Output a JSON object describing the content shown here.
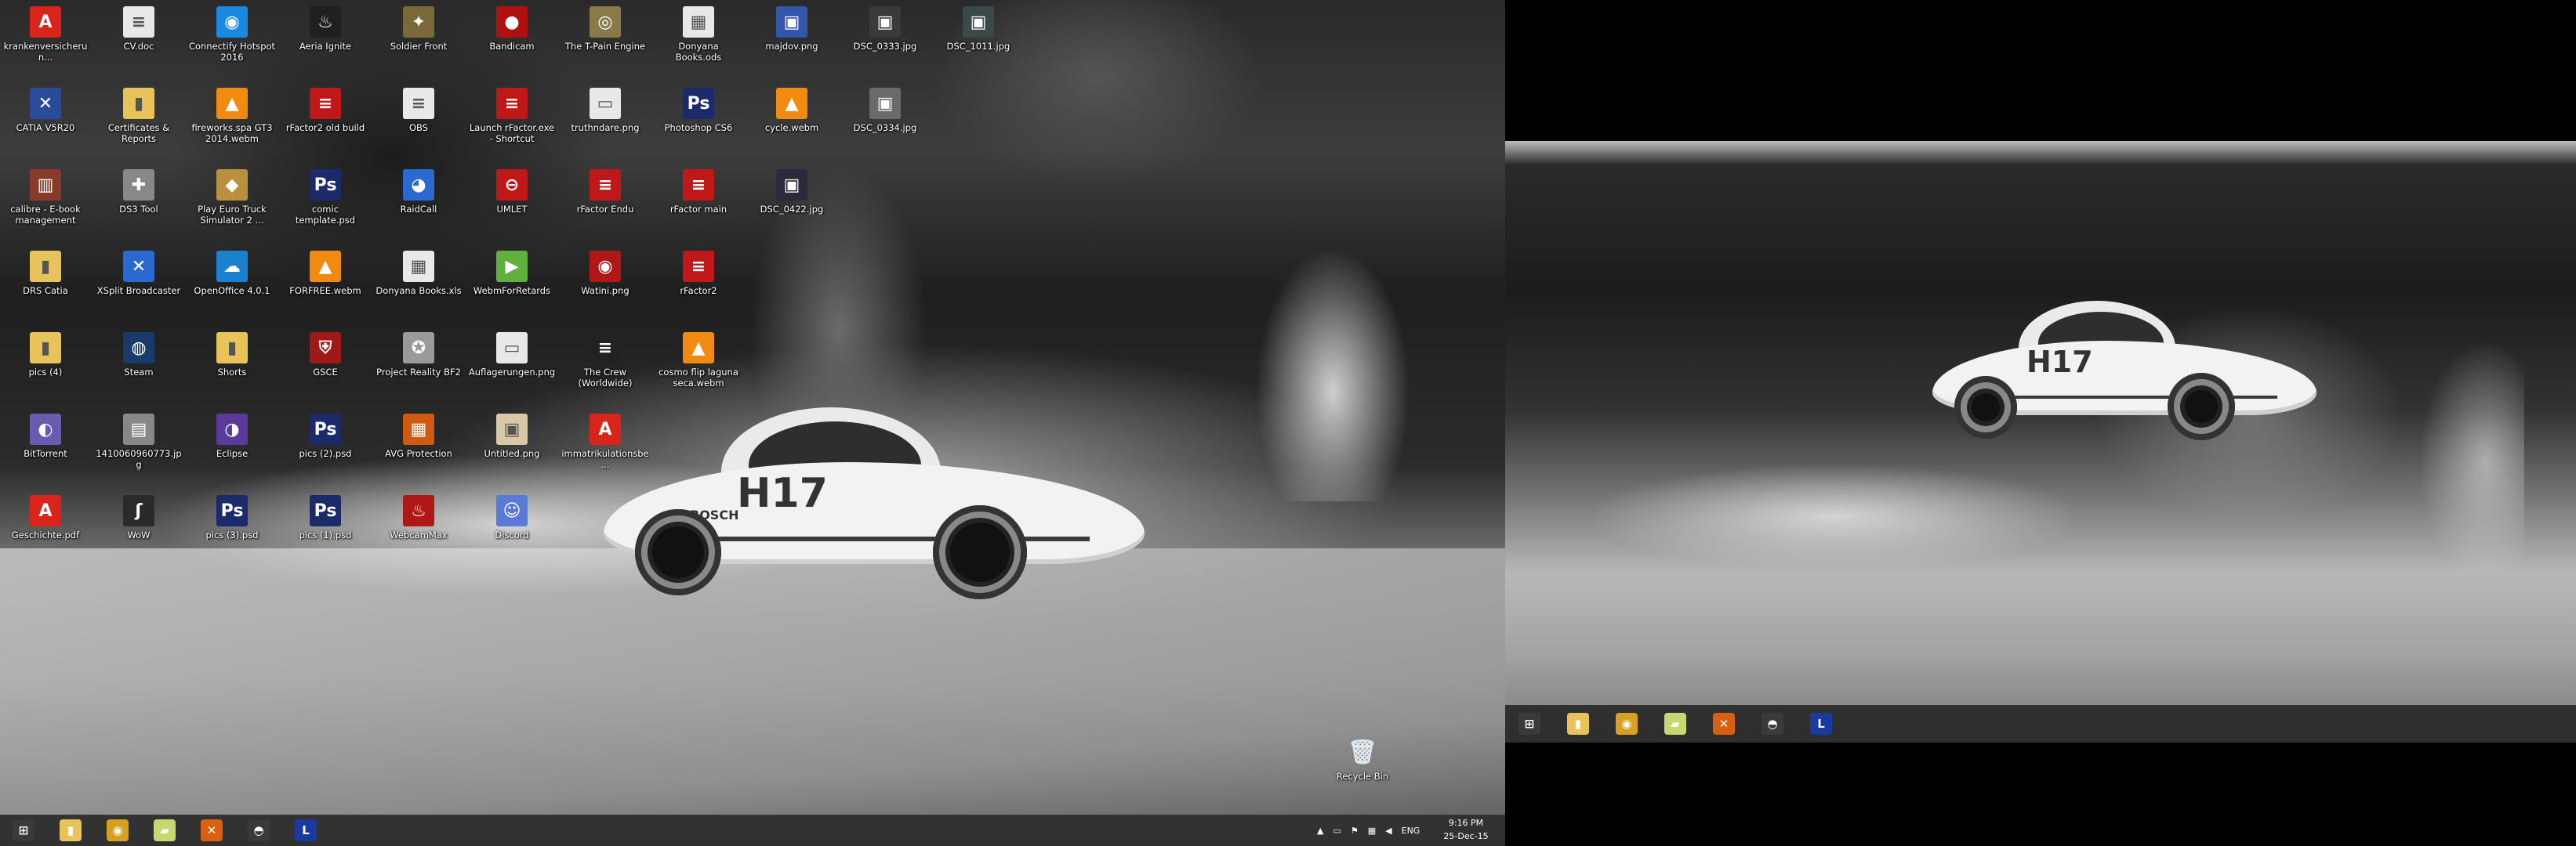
{
  "desktop_left": {
    "icons": [
      {
        "label": "krankenversicherun...",
        "kind": "pdf-icon",
        "color": "#d9241c",
        "glyph": "A"
      },
      {
        "label": "CV.doc",
        "kind": "document-icon",
        "color": "#e8e8e8",
        "glyph": "≡"
      },
      {
        "label": "Connectify Hotspot 2016",
        "kind": "wifi-app-icon",
        "color": "#1a8ae0",
        "glyph": "◉"
      },
      {
        "label": "Aeria Ignite",
        "kind": "flame-app-icon",
        "color": "#202020",
        "glyph": "♨"
      },
      {
        "label": "Soldier Front",
        "kind": "game-emblem-icon",
        "color": "#7a6a3a",
        "glyph": "✦"
      },
      {
        "label": "Bandicam",
        "kind": "record-app-icon",
        "color": "#b01010",
        "glyph": "●"
      },
      {
        "label": "The T-Pain Engine",
        "kind": "medallion-icon",
        "color": "#8a7a4a",
        "glyph": "◎"
      },
      {
        "label": "Donyana Books.ods",
        "kind": "spreadsheet-icon",
        "color": "#e8e8e8",
        "glyph": "▦"
      },
      {
        "label": "majdov.png",
        "kind": "image-file-icon",
        "color": "#3355aa",
        "glyph": "▣"
      },
      {
        "label": "DSC_0333.jpg",
        "kind": "photo-icon",
        "color": "#3a3a3a",
        "glyph": "▣"
      },
      {
        "label": "DSC_1011.jpg",
        "kind": "photo-icon",
        "color": "#3a4a48",
        "glyph": "▣"
      },
      {
        "label": "CATIA V5R20",
        "kind": "catia-icon",
        "color": "#2a4a9a",
        "glyph": "✕"
      },
      {
        "label": "Certificates & Reports",
        "kind": "folder-icon",
        "color": "#e8c35a",
        "glyph": "▮"
      },
      {
        "label": "fireworks.spa GT3 2014.webm",
        "kind": "vlc-cone-icon",
        "color": "#f08a10",
        "glyph": "▲"
      },
      {
        "label": "rFactor2 old build",
        "kind": "rfactor-icon",
        "color": "#c01818",
        "glyph": "≡"
      },
      {
        "label": "OBS",
        "kind": "document-icon",
        "color": "#e8e8e8",
        "glyph": "≡"
      },
      {
        "label": "Launch rFactor.exe - Shortcut",
        "kind": "rfactor-icon",
        "color": "#c01818",
        "glyph": "≡"
      },
      {
        "label": "truthndare.png",
        "kind": "image-file-icon",
        "color": "#e8e8e8",
        "glyph": "▭"
      },
      {
        "label": "Photoshop CS6",
        "kind": "photoshop-icon",
        "color": "#1a2a6a",
        "glyph": "Ps"
      },
      {
        "label": "cycle.webm",
        "kind": "vlc-cone-icon",
        "color": "#f08a10",
        "glyph": "▲"
      },
      {
        "label": "DSC_0334.jpg",
        "kind": "photo-icon",
        "color": "#6a6a6a",
        "glyph": "▣"
      },
      {
        "label": "calibre - E-book management",
        "kind": "books-icon",
        "color": "#8a3a2a",
        "glyph": "▥"
      },
      {
        "label": "DS3 Tool",
        "kind": "gamepad-icon",
        "color": "#888888",
        "glyph": "✚"
      },
      {
        "label": "Play Euro Truck Simulator 2 ...",
        "kind": "truck-game-icon",
        "color": "#b89040",
        "glyph": "◆"
      },
      {
        "label": "comic template.psd",
        "kind": "photoshop-icon",
        "color": "#1a2a6a",
        "glyph": "Ps"
      },
      {
        "label": "RaidCall",
        "kind": "chat-app-icon",
        "color": "#2a6ad0",
        "glyph": "◕"
      },
      {
        "label": "UMLET",
        "kind": "london-roundel-icon",
        "color": "#c01818",
        "glyph": "⊖"
      },
      {
        "label": "rFactor Endu",
        "kind": "rfactor-icon",
        "color": "#c01818",
        "glyph": "≡"
      },
      {
        "label": "rFactor main",
        "kind": "rfactor-icon",
        "color": "#c01818",
        "glyph": "≡"
      },
      {
        "label": "DSC_0422.jpg",
        "kind": "photo-icon",
        "color": "#2a2a3a",
        "glyph": "▣"
      },
      {
        "label": "DRS Catia",
        "kind": "folder-icon",
        "color": "#e8c35a",
        "glyph": "▮"
      },
      {
        "label": "XSplit Broadcaster",
        "kind": "broadcast-app-icon",
        "color": "#2a6ad0",
        "glyph": "✕"
      },
      {
        "label": "OpenOffice 4.0.1",
        "kind": "openoffice-icon",
        "color": "#1a80d0",
        "glyph": "☁"
      },
      {
        "label": "FORFREE.webm",
        "kind": "vlc-cone-icon",
        "color": "#f08a10",
        "glyph": "▲"
      },
      {
        "label": "Donyana Books.xls",
        "kind": "spreadsheet-icon",
        "color": "#e8e8e8",
        "glyph": "▦"
      },
      {
        "label": "WebmForRetards",
        "kind": "play-arrow-icon",
        "color": "#60b040",
        "glyph": "▶"
      },
      {
        "label": "Watini.png",
        "kind": "image-file-icon",
        "color": "#b01818",
        "glyph": "◉"
      },
      {
        "label": "rFactor2",
        "kind": "rfactor-icon",
        "color": "#c01818",
        "glyph": "≡"
      },
      {
        "label": "pics (4)",
        "kind": "folder-icon",
        "color": "#e8c35a",
        "glyph": "▮"
      },
      {
        "label": "Steam",
        "kind": "steam-icon",
        "color": "#1a3a6a",
        "glyph": "◍"
      },
      {
        "label": "Shorts",
        "kind": "folder-icon",
        "color": "#e8c35a",
        "glyph": "▮"
      },
      {
        "label": "GSCE",
        "kind": "racing-game-icon",
        "color": "#a01818",
        "glyph": "⛨"
      },
      {
        "label": "Project Reality BF2",
        "kind": "game-emblem-icon",
        "color": "#9a9a9a",
        "glyph": "✪"
      },
      {
        "label": "Auflagerungen.png",
        "kind": "image-file-icon",
        "color": "#e8e8e8",
        "glyph": "▭"
      },
      {
        "label": "The Crew (Worldwide)",
        "kind": "crew-game-icon",
        "color": "#222222",
        "glyph": "≡"
      },
      {
        "label": "cosmo flip laguna seca.webm",
        "kind": "vlc-cone-icon",
        "color": "#f08a10",
        "glyph": "▲"
      },
      {
        "label": "BitTorrent",
        "kind": "torrent-icon",
        "color": "#6a5ab0",
        "glyph": "◐"
      },
      {
        "label": "1410060960773.jpg",
        "kind": "photo-icon",
        "color": "#888888",
        "glyph": "▤"
      },
      {
        "label": "Eclipse",
        "kind": "eclipse-icon",
        "color": "#5a3a9a",
        "glyph": "◑"
      },
      {
        "label": "pics (2).psd",
        "kind": "photoshop-icon",
        "color": "#1a2a6a",
        "glyph": "Ps"
      },
      {
        "label": "AVG Protection",
        "kind": "avg-icon",
        "color": "#d05a10",
        "glyph": "▦"
      },
      {
        "label": "Untitled.png",
        "kind": "image-file-icon",
        "color": "#d8c8a8",
        "glyph": "▣"
      },
      {
        "label": "immatrikulationsbe...",
        "kind": "pdf-icon",
        "color": "#d9241c",
        "glyph": "A"
      },
      {
        "label": "Geschichte.pdf",
        "kind": "pdf-icon",
        "color": "#d9241c",
        "glyph": "A"
      },
      {
        "label": "WoW",
        "kind": "leaf-app-icon",
        "color": "#2a2a2a",
        "glyph": "ʃ"
      },
      {
        "label": "pics (3).psd",
        "kind": "photoshop-icon",
        "color": "#1a2a6a",
        "glyph": "Ps"
      },
      {
        "label": "pics (1).psd",
        "kind": "photoshop-icon",
        "color": "#1a2a6a",
        "glyph": "Ps"
      },
      {
        "label": "WebcamMax",
        "kind": "flame-app-icon",
        "color": "#b01818",
        "glyph": "♨"
      },
      {
        "label": "Discord",
        "kind": "discord-icon",
        "color": "#5a7ad8",
        "glyph": "☺"
      }
    ],
    "recycle_bin": {
      "label": "Recycle Bin",
      "kind": "recycle-bin-icon",
      "glyph": "🗑"
    }
  },
  "taskbar_left": {
    "buttons": [
      {
        "name": "start-button",
        "kind": "windows-logo-icon",
        "glyph": "⊞",
        "color": "#3a3a3a"
      },
      {
        "name": "taskbar-file-explorer",
        "kind": "folder-icon",
        "glyph": "▮",
        "color": "#e8c35a"
      },
      {
        "name": "taskbar-chrome",
        "kind": "chrome-icon",
        "glyph": "◉",
        "color": "#d8a020"
      },
      {
        "name": "taskbar-libraries",
        "kind": "libraries-icon",
        "glyph": "▰",
        "color": "#c8d870"
      },
      {
        "name": "taskbar-xsplit",
        "kind": "broadcast-app-icon",
        "glyph": "✕",
        "color": "#d86010"
      },
      {
        "name": "taskbar-helmet-app",
        "kind": "helmet-icon",
        "glyph": "◓",
        "color": "#3a3a3a"
      },
      {
        "name": "taskbar-launcher-app",
        "kind": "launcher-icon",
        "glyph": "L",
        "color": "#1a3aa0"
      }
    ],
    "tray": {
      "language": "ENG",
      "time": "9:16 PM",
      "date": "25-Dec-15"
    }
  },
  "taskbar_right": {
    "buttons": [
      {
        "name": "start-button-2",
        "kind": "windows-logo-icon",
        "glyph": "⊞",
        "color": "#3a3a3a"
      },
      {
        "name": "taskbar2-file-explorer",
        "kind": "folder-icon",
        "glyph": "▮",
        "color": "#e8c35a"
      },
      {
        "name": "taskbar2-chrome",
        "kind": "chrome-icon",
        "glyph": "◉",
        "color": "#d8a020"
      },
      {
        "name": "taskbar2-libraries",
        "kind": "libraries-icon",
        "glyph": "▰",
        "color": "#c8d870"
      },
      {
        "name": "taskbar2-xsplit",
        "kind": "broadcast-app-icon",
        "glyph": "✕",
        "color": "#d86010"
      },
      {
        "name": "taskbar2-helmet-app",
        "kind": "helmet-icon",
        "glyph": "◓",
        "color": "#3a3a3a"
      },
      {
        "name": "taskbar2-launcher-app",
        "kind": "launcher-icon",
        "glyph": "L",
        "color": "#1a3aa0"
      }
    ]
  },
  "wallpaper": {
    "car_number": "H17",
    "sponsor": "BOSCH"
  }
}
